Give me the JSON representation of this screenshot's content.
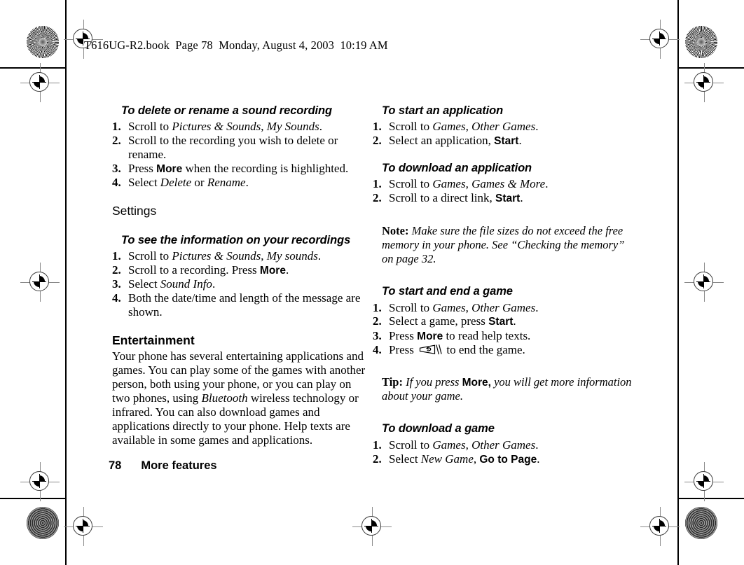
{
  "header": {
    "file_info": "T616UG-R2.book  Page 78  Monday, August 4, 2003  10:19 AM"
  },
  "footer": {
    "page_number": "78",
    "chapter": "More features"
  },
  "left_column": {
    "block1": {
      "heading": "To delete or rename a sound recording",
      "steps": [
        {
          "num": "1.",
          "prefix": "Scroll to ",
          "italic1": "Pictures & Sounds",
          "mid": ", ",
          "italic2": "My Sounds",
          "suffix": "."
        },
        {
          "num": "2.",
          "prefix": "Scroll to the recording you wish to delete or rename.",
          "italic1": "",
          "mid": "",
          "italic2": "",
          "suffix": ""
        },
        {
          "num": "3.",
          "prefix": "Press ",
          "ui": "More",
          "suffix": " when the recording is highlighted."
        },
        {
          "num": "4.",
          "prefix": "Select ",
          "italic1": "Delete",
          "mid": " or ",
          "italic2": "Rename",
          "suffix": "."
        }
      ]
    },
    "settings_heading": "Settings",
    "block2": {
      "heading": "To see the information on your recordings",
      "steps": [
        {
          "num": "1.",
          "prefix": "Scroll to ",
          "italic1": "Pictures & Sounds",
          "mid": ", ",
          "italic2": "My sounds",
          "suffix": "."
        },
        {
          "num": "2.",
          "prefix": "Scroll to a recording. Press ",
          "ui": "More",
          "suffix": "."
        },
        {
          "num": "3.",
          "prefix": "Select ",
          "italic1": "Sound Info",
          "suffix": "."
        },
        {
          "num": "4.",
          "prefix": "Both the date/time and length of the message are shown.",
          "suffix": ""
        }
      ]
    },
    "entertainment": {
      "heading": "Entertainment",
      "body_part1": "Your phone has several entertaining applications and games. You can play some of the games with another person, both using your phone, or you can play on two phones, using ",
      "body_italic": "Bluetooth",
      "body_part2": " wireless technology or infrared. You can also download games and applications directly to your phone. Help texts are available in some games and applications."
    }
  },
  "right_column": {
    "block1": {
      "heading": "To start an application",
      "steps": [
        {
          "num": "1.",
          "prefix": "Scroll to ",
          "italic1": "Games",
          "mid": ", ",
          "italic2": "Other Games",
          "suffix": "."
        },
        {
          "num": "2.",
          "prefix": "Select an application, ",
          "ui": "Start",
          "suffix": "."
        }
      ]
    },
    "block2": {
      "heading": "To download an application",
      "steps": [
        {
          "num": "1.",
          "prefix": "Scroll to ",
          "italic1": "Games",
          "mid": ", ",
          "italic2": "Games & More",
          "suffix": "."
        },
        {
          "num": "2.",
          "prefix": "Scroll to a direct link, ",
          "ui": "Start",
          "suffix": "."
        }
      ]
    },
    "note": {
      "lead": "Note:",
      "text": " Make sure the file sizes do not exceed the free memory in your phone. See “Checking the memory” on page 32."
    },
    "block3": {
      "heading": "To start and end a game",
      "steps": [
        {
          "num": "1.",
          "prefix": "Scroll to ",
          "italic1": "Games",
          "mid": ", ",
          "italic2": "Other Games",
          "suffix": "."
        },
        {
          "num": "2.",
          "prefix": "Select a game, press ",
          "ui": "Start",
          "suffix": "."
        },
        {
          "num": "3.",
          "prefix": "Press ",
          "ui": "More",
          "suffix": " to read help texts."
        },
        {
          "num": "4.",
          "prefix": "Press ",
          "icon": "clear-key-icon",
          "suffix": " to end the game."
        }
      ]
    },
    "tip": {
      "lead": "Tip:",
      "text_before": " If you press ",
      "ui": "More,",
      "text_after": " you will get more information about your game."
    },
    "block4": {
      "heading": "To download a game",
      "steps": [
        {
          "num": "1.",
          "prefix": "Scroll to ",
          "italic1": "Games",
          "mid": ", ",
          "italic2": "Other Games",
          "suffix": "."
        },
        {
          "num": "2.",
          "prefix": "Select ",
          "italic1": "New Game",
          "mid": ", ",
          "ui": "Go to Page",
          "suffix": "."
        }
      ]
    }
  },
  "colors": {
    "ink": "#000000",
    "registration_line": "#8a8a8a",
    "page_rule": "#000000"
  }
}
